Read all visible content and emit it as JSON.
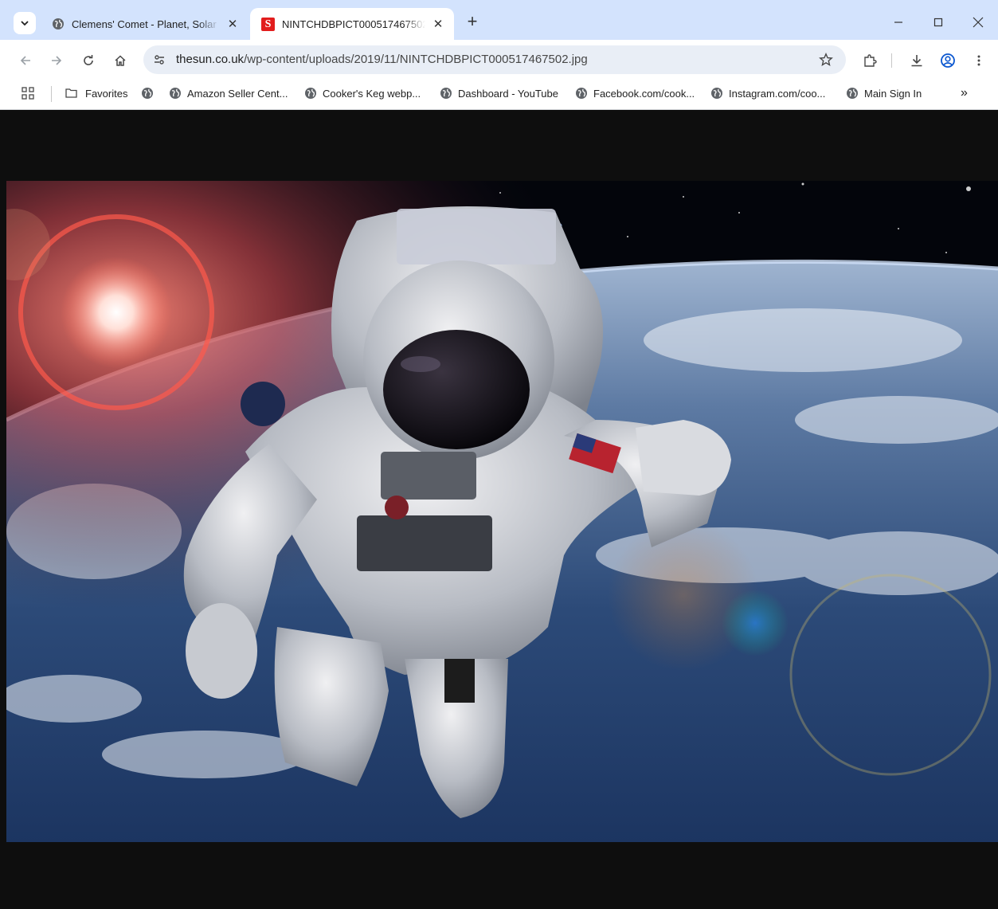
{
  "tabs": [
    {
      "title": "Clemens' Comet - Planet, Solar",
      "favicon": "globe-icon",
      "active": false
    },
    {
      "title": "NINTCHDBPICT000517467502.jpg",
      "favicon": "the-sun-logo",
      "active": true
    }
  ],
  "sun_logo_letter": "S",
  "new_tab_label": "+",
  "address_bar": {
    "url_host": "thesun.co.uk",
    "url_path": "/wp-content/uploads/2019/11/NINTCHDBPICT000517467502.jpg"
  },
  "bookmarks": [
    {
      "label": "Favorites",
      "icon": "folder-icon"
    },
    {
      "label": "",
      "icon": "globe-icon"
    },
    {
      "label": "Amazon Seller Cent...",
      "icon": "globe-icon"
    },
    {
      "label": "Cooker's Keg webp...",
      "icon": "globe-icon"
    },
    {
      "label": "Dashboard - YouTube",
      "icon": "globe-icon"
    },
    {
      "label": "Facebook.com/cook...",
      "icon": "globe-icon"
    },
    {
      "label": "Instagram.com/coo...",
      "icon": "globe-icon"
    },
    {
      "label": "Main Sign In",
      "icon": "globe-icon"
    }
  ],
  "overflow_label": "»",
  "colors": {
    "tabstrip_bg": "#d3e3fd",
    "omnibox_bg": "#e9eef6",
    "viewport_bg": "#0e0e0e",
    "profile_accent": "#0b57d0",
    "sun_red": "#e21d1d"
  }
}
